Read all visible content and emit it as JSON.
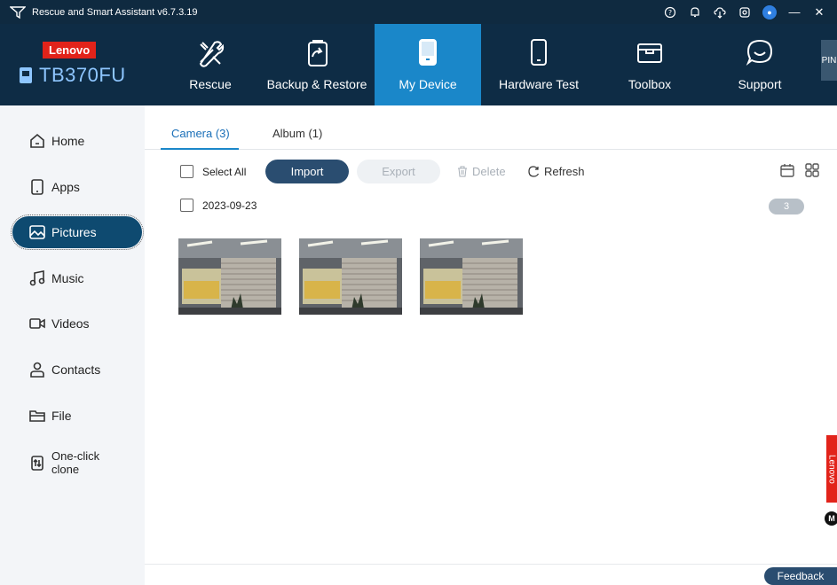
{
  "titlebar": {
    "title": "Rescue and Smart Assistant v6.7.3.19",
    "icons": [
      "help-icon",
      "notification-icon",
      "cloud-icon",
      "settings-icon",
      "user-avatar-icon",
      "minimize-icon",
      "close-icon"
    ],
    "help": "?",
    "bell": "♫",
    "minimize": "—",
    "close": "✕"
  },
  "brand": {
    "lenovo": "Lenovo",
    "device_name": "TB370FU"
  },
  "nav": {
    "tabs": [
      {
        "label": "Rescue",
        "icon": "tools-icon"
      },
      {
        "label": "Backup & Restore",
        "icon": "backup-icon"
      },
      {
        "label": "My Device",
        "icon": "device-icon",
        "active": true
      },
      {
        "label": "Hardware Test",
        "icon": "phone-icon"
      },
      {
        "label": "Toolbox",
        "icon": "toolbox-icon"
      },
      {
        "label": "Support",
        "icon": "chat-icon"
      }
    ],
    "pin": "PIN"
  },
  "sidebar": {
    "items": [
      {
        "label": "Home",
        "icon": "home-icon"
      },
      {
        "label": "Apps",
        "icon": "apps-icon"
      },
      {
        "label": "Pictures",
        "icon": "pictures-icon",
        "active": true
      },
      {
        "label": "Music",
        "icon": "music-icon"
      },
      {
        "label": "Videos",
        "icon": "videos-icon"
      },
      {
        "label": "Contacts",
        "icon": "contacts-icon"
      },
      {
        "label": "File",
        "icon": "folder-icon"
      },
      {
        "label": "One-click clone",
        "icon": "clone-icon"
      }
    ]
  },
  "main": {
    "tabs": [
      {
        "label": "Camera (3)",
        "active": true
      },
      {
        "label": "Album (1)"
      }
    ],
    "toolbar": {
      "select_all": "Select All",
      "import": "Import",
      "export": "Export",
      "delete": "Delete",
      "refresh": "Refresh"
    },
    "group": {
      "date": "2023-09-23",
      "count": "3"
    },
    "feedback": "Feedback",
    "side_brand": "Lenovo",
    "moto": "M"
  },
  "colors": {
    "header_bg": "#0e2c45",
    "active_tab": "#1a87c9",
    "sidebar_active": "#0e4a70",
    "primary_button": "#2a4d70",
    "lenovo_red": "#e2231a"
  }
}
